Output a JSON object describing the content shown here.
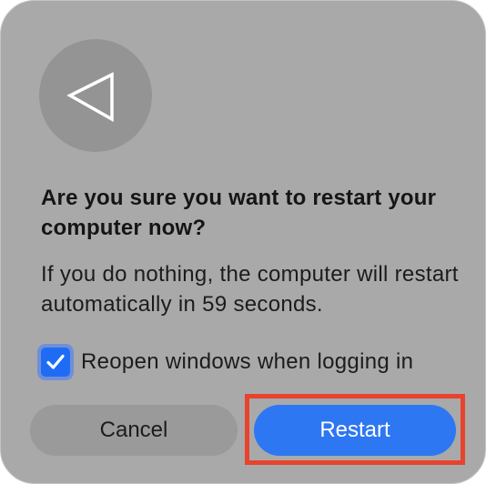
{
  "dialog": {
    "icon": "restart-back-arrow-icon",
    "title": "Are you sure you want to restart your computer now?",
    "message": "If you do nothing, the computer will restart automatically in 59 seconds.",
    "checkbox": {
      "label": "Reopen windows when logging in",
      "checked": true
    },
    "buttons": {
      "cancel_label": "Cancel",
      "restart_label": "Restart"
    }
  },
  "colors": {
    "dialog_background": "#a9a9a9",
    "accent": "#2e77f2",
    "highlight": "#e8432e"
  }
}
